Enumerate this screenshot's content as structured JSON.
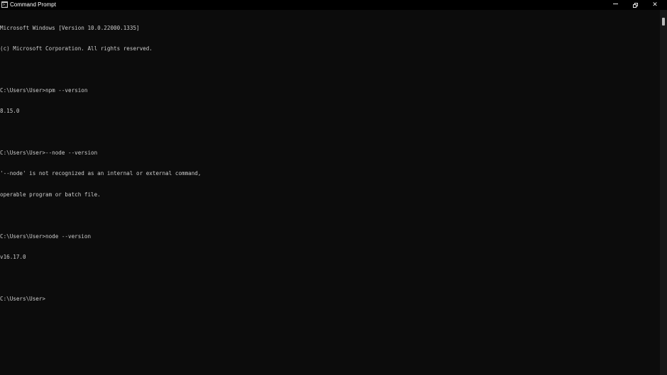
{
  "window": {
    "title": "Command Prompt",
    "icon": "cmd-icon",
    "controls": {
      "minimize": "minimize-icon",
      "restore": "restore-icon",
      "close": "✕"
    }
  },
  "console": {
    "lines": [
      "Microsoft Windows [Version 10.0.22000.1335]",
      "(c) Microsoft Corporation. All rights reserved.",
      "",
      "C:\\Users\\User>npm --version",
      "8.15.0",
      "",
      "C:\\Users\\User>--node --version",
      "'--node' is not recognized as an internal or external command,",
      "operable program or batch file.",
      "",
      "C:\\Users\\User>node --version",
      "v16.17.0",
      "",
      "C:\\Users\\User>"
    ]
  },
  "colors": {
    "background": "#0c0c0c",
    "titlebar": "#000000",
    "text": "#cccccc"
  }
}
